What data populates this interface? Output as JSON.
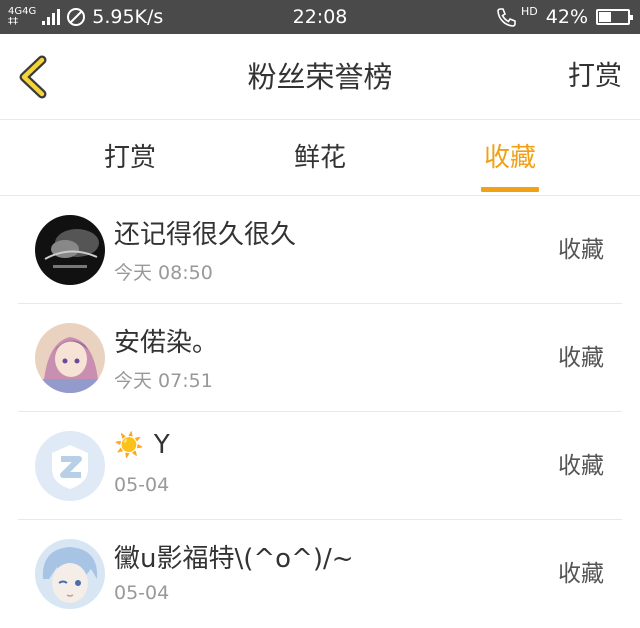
{
  "status_bar": {
    "network_top": "4G4G",
    "network_bottom": "‡‡",
    "speed": "5.95K/s",
    "time": "22:08",
    "hd": "HD",
    "battery": "42%",
    "battery_level": 0.42
  },
  "header": {
    "title": "粉丝荣誉榜",
    "action_label": "打赏",
    "accent_color": "#f0a116"
  },
  "tabs": [
    {
      "label": "打赏",
      "active": false
    },
    {
      "label": "鲜花",
      "active": false
    },
    {
      "label": "收藏",
      "active": true
    }
  ],
  "rows": [
    {
      "name": "还记得很久很久",
      "time": "今天 08:50",
      "action": "收藏",
      "avatar": "dark-photo-avatar"
    },
    {
      "name": "安偌染。",
      "time": "今天 07:51",
      "action": "收藏",
      "avatar": "anime-girl-avatar"
    },
    {
      "name": "Y",
      "emoji": "☀️",
      "time": "05-04",
      "action": "收藏",
      "avatar": "default-qq-avatar"
    },
    {
      "name": "黴u影福特\\(^o^)/~",
      "time": "05-04",
      "action": "收藏",
      "avatar": "anime-boy-avatar"
    }
  ]
}
